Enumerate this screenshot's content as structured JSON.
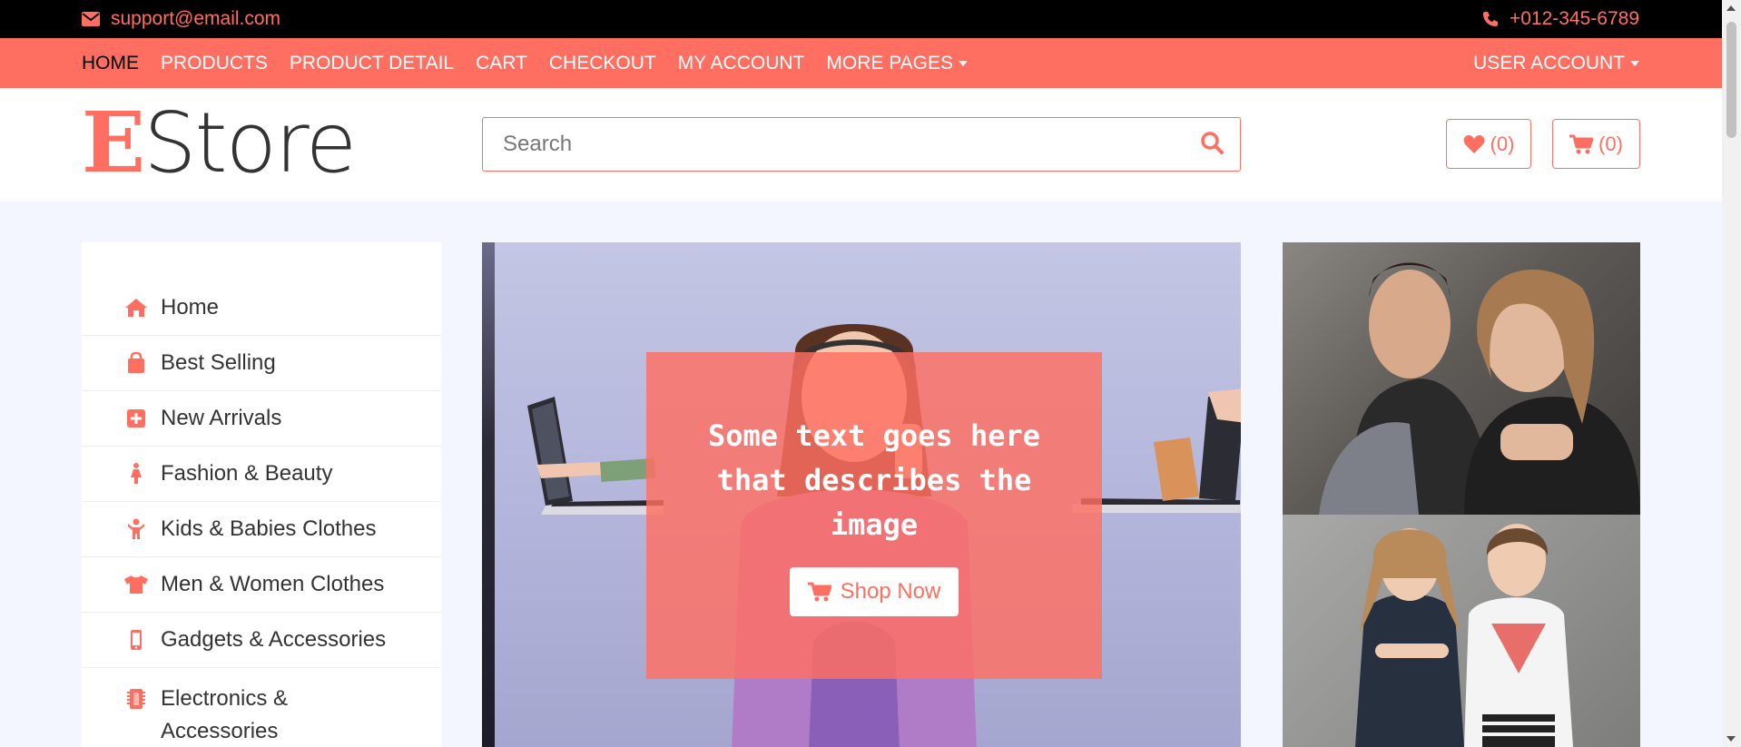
{
  "topbar": {
    "email": "support@email.com",
    "phone": "+012-345-6789",
    "email_icon": "envelope-icon",
    "phone_icon": "phone-icon"
  },
  "nav": {
    "items": [
      {
        "label": "HOME",
        "active": true
      },
      {
        "label": "PRODUCTS"
      },
      {
        "label": "PRODUCT DETAIL"
      },
      {
        "label": "CART"
      },
      {
        "label": "CHECKOUT"
      },
      {
        "label": "MY ACCOUNT"
      },
      {
        "label": "MORE PAGES"
      }
    ],
    "user_account": "USER ACCOUNT"
  },
  "header": {
    "logo_first": "E",
    "logo_rest": "Store",
    "search_placeholder": "Search",
    "wishlist_count": "(0)",
    "cart_count": "(0)"
  },
  "sidebar": {
    "items": [
      {
        "label": "Home",
        "icon": "home-icon"
      },
      {
        "label": "Best Selling",
        "icon": "shopping-bag-icon"
      },
      {
        "label": "New Arrivals",
        "icon": "plus-square-icon"
      },
      {
        "label": "Fashion & Beauty",
        "icon": "female-icon"
      },
      {
        "label": "Kids & Babies Clothes",
        "icon": "child-icon"
      },
      {
        "label": "Men & Women Clothes",
        "icon": "tshirt-icon"
      },
      {
        "label": "Gadgets & Accessories",
        "icon": "mobile-icon"
      },
      {
        "label": "Electronics & Accessories",
        "icon": "microchip-icon"
      }
    ]
  },
  "hero": {
    "caption": "Some text goes here that describes the image",
    "button_label": "Shop Now"
  },
  "colors": {
    "accent": "#ff6f61",
    "topbar_bg": "#000000",
    "page_bg": "#f3f6ff"
  }
}
